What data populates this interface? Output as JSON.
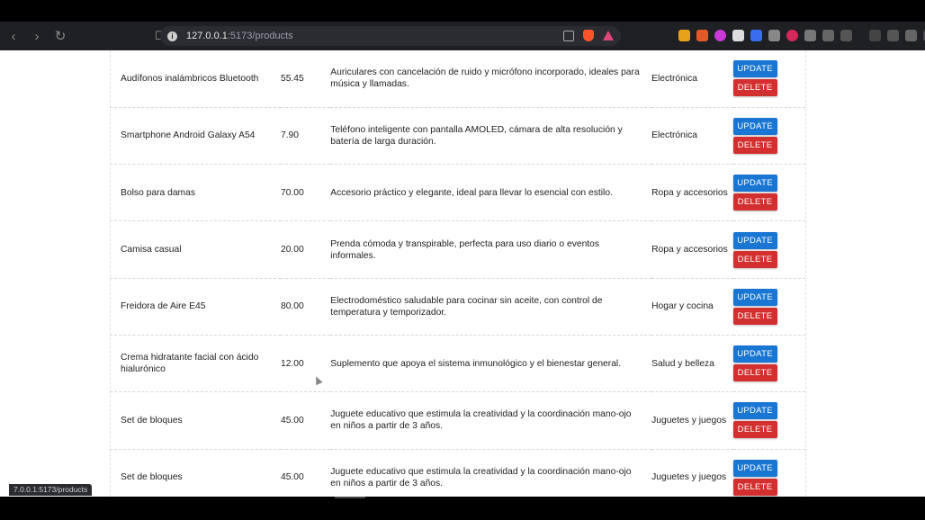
{
  "browser": {
    "url_host": "127.0.0.1",
    "url_path": ":5173/products",
    "status_url": "7.0.0.1:5173/products"
  },
  "actions": {
    "update_label": "UPDATE",
    "delete_label": "DELETE"
  },
  "products": [
    {
      "name": "Audífonos inalámbricos Bluetooth",
      "price": "55.45",
      "description": "Auriculares con cancelación de ruido y micrófono incorporado, ideales para música y llamadas.",
      "category": "Electrónica"
    },
    {
      "name": "Smartphone Android Galaxy A54",
      "price": "7.90",
      "description": "Teléfono inteligente con pantalla AMOLED, cámara de alta resolución y batería de larga duración.",
      "category": "Electrónica"
    },
    {
      "name": "Bolso para damas",
      "price": "70.00",
      "description": "Accesorio práctico y elegante, ideal para llevar lo esencial con estilo.",
      "category": "Ropa y accesorios"
    },
    {
      "name": "Camisa casual",
      "price": "20.00",
      "description": "Prenda cómoda y transpirable, perfecta para uso diario o eventos informales.",
      "category": "Ropa y accesorios"
    },
    {
      "name": "Freidora de Aire E45",
      "price": "80.00",
      "description": "Electrodoméstico saludable para cocinar sin aceite, con control de temperatura y temporizador.",
      "category": "Hogar y cocina"
    },
    {
      "name": "Crema hidratante facial con ácido hialurónico",
      "price": "12.00",
      "description": "Suplemento que apoya el sistema inmunológico y el bienestar general.",
      "category": "Salud y belleza"
    },
    {
      "name": "Set de bloques",
      "price": "45.00",
      "description": "Juguete educativo que estimula la creatividad y la coordinación mano-ojo en niños a partir de 3 años.",
      "category": "Juguetes y juegos"
    },
    {
      "name": "Set de bloques",
      "price": "45.00",
      "description": "Juguete educativo que estimula la creatividad y la coordinación mano-ojo en niños a partir de 3 años.",
      "category": "Juguetes y juegos"
    }
  ]
}
